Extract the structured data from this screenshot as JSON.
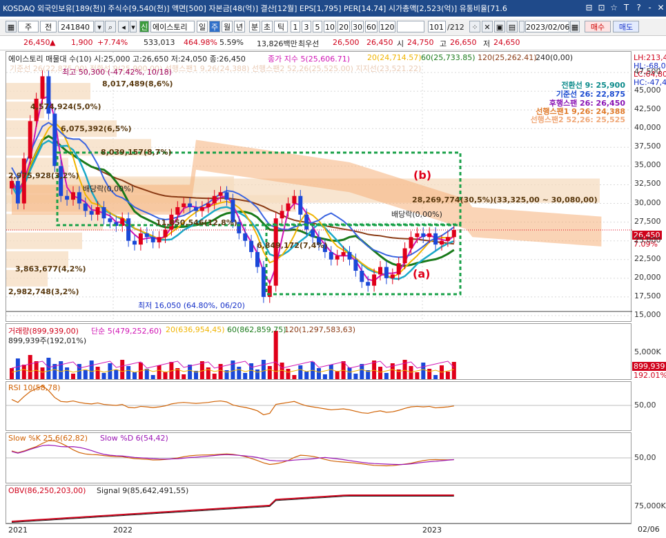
{
  "window": {
    "title": "KOSDAQ 외국인보유[189(천)] 주식수[9,540(천)] 액면[500] 자본금[48(억)] 결산[12월] EPS[1,795] PER[14.74] 시가총액[2,523(억)] 유통비율[71.6",
    "buttons": [
      "⊟",
      "⊡",
      "☆",
      "T",
      "?",
      "-",
      "✕"
    ]
  },
  "toolbar": {
    "code": "241840",
    "period_short": "주",
    "period_kind": "전",
    "stock_tag": "신",
    "stock_name": "에이스토리",
    "periods": [
      "일",
      "주",
      "월",
      "년",
      "분",
      "초",
      "틱"
    ],
    "active_period": "주",
    "ticks": [
      "1",
      "3",
      "5",
      "10",
      "20",
      "30",
      "60",
      "120"
    ],
    "count": "101",
    "count_total": "/212",
    "date": "2023/02/06",
    "buy": "매수",
    "sell": "매도"
  },
  "quote": {
    "price": "26,450",
    "arrow": "▲",
    "change": "1,900",
    "change_pct": "+7.74%",
    "volume": "533,013",
    "vol_ratio": "464.98%",
    "turnover": "5.59%",
    "amount": "13,826백만",
    "quote_side": "최우선",
    "bid": "26,500",
    "ask": "26,450",
    "open_label": "시",
    "open": "24,750",
    "high_label": "고",
    "high": "26,650",
    "low_label": "저",
    "low": "24,650"
  },
  "price_pane": {
    "header": "에이스토리 매물대 수(10)  시:25,000 고:26,650 저:24,050 종:26,450",
    "ma_items": [
      {
        "label": "종가 지수 5(25,606.71)",
        "color": "#d014b4"
      },
      {
        "label": "20(24,714.57)",
        "color": "#f0b400"
      },
      {
        "label": "60(25,733.85)",
        "color": "#1a7a1a"
      },
      {
        "label": "120(25,262.41)",
        "color": "#8a3a14"
      },
      {
        "label": "240(0,00)",
        "color": "#222222"
      }
    ],
    "ichimoku_header": "기준선 26(22,875.00) 전환선 9(25,900.00) 선행스팬1 9,26(24,388) 선행스팬2 52,26(25,525.00)  지지선(23,521.22)",
    "ichimoku_legend": [
      {
        "label": "전환선 9: 25,900",
        "color": "#0a8a8a"
      },
      {
        "label": "기준선 26: 22,875",
        "color": "#1a4ad0"
      },
      {
        "label": "후행스팬 26: 26,450",
        "color": "#8a14b4"
      },
      {
        "label": "선행스팬1 9,26: 24,388",
        "color": "#e07a2a"
      },
      {
        "label": "선행스팬2 52,26: 25,525",
        "color": "#f0a878"
      }
    ],
    "right_tags": [
      {
        "label": "LH:213,40",
        "color": "#d0021b"
      },
      {
        "label": "HL:-68,09",
        "color": "#1530c8"
      },
      {
        "label": "LC:64,80",
        "color": "#d0021b"
      },
      {
        "label": "HC:-47,42",
        "color": "#1530c8"
      }
    ],
    "y_ticks": [
      "47,500",
      "45,000",
      "42,500",
      "40,000",
      "37,500",
      "35,000",
      "32,500",
      "30,000",
      "27,500",
      "25,000",
      "22,500",
      "20,000",
      "17,500",
      "15,000"
    ],
    "current_price_tag": "26,450",
    "current_pct_tag": "7.09%",
    "annotations": {
      "high": "최고 50,300 (-47.42%, 10/18)",
      "low": "최저 16,050 (64.80%, 06/20)",
      "vp1": "8,017,489(8,6%)",
      "vp2": "4,574,924(5,0%)",
      "vp3": "6,075,392(6,5%)",
      "vp4": "8,039,157(8,7%)",
      "vp5": "2,975,928(3,2%)",
      "vp6": "11,850,546(12,8%)",
      "vp7": "6,849,172(7,4%)",
      "vp8": "28,269,774(30,5%)(33,325,00 ~ 30,080,00)",
      "vp9": "3,863,677(4,2%)",
      "vp10": "2,982,748(3,2%)",
      "div1": "배당락(0,00%)",
      "div2": "배당락(0,00%)",
      "box_a": "(a)",
      "box_b": "(b)"
    }
  },
  "volume_pane": {
    "legend": [
      {
        "label": "거래량(899,939,00)",
        "color": "#d0021b"
      },
      {
        "label": "단순 5(479,252,60)",
        "color": "#d014b4"
      },
      {
        "label": "20(636,954,45)",
        "color": "#f0b400"
      },
      {
        "label": "60(862,859,75)",
        "color": "#1a7a1a"
      },
      {
        "label": "120(1,297,583,63)",
        "color": "#8a3a14"
      }
    ],
    "sub": "899,939주(192,01%)",
    "y_ticks": [
      "5,000K"
    ],
    "tag_value": "899,939",
    "tag_pct": "192.01%"
  },
  "rsi_pane": {
    "legend": "RSI 10(58,78)",
    "y_ticks": [
      "50,00"
    ]
  },
  "stoch_pane": {
    "legend_k": "Slow %K 25,6(62,82)",
    "legend_d": "Slow %D 6(54,42)",
    "y_ticks": [
      "50,00"
    ]
  },
  "obv_pane": {
    "legend_obv": "OBV(86,250,203,00)",
    "legend_sig": "Signal 9(85,642,491,55)",
    "y_ticks": [
      "75,000K"
    ]
  },
  "x_axis": {
    "labels": [
      "2021",
      "2022",
      "2023"
    ],
    "right": "02/06"
  },
  "chart_data": {
    "type": "candlestick",
    "y_axis_range": [
      15000,
      47500
    ],
    "closes": [
      33000,
      30000,
      36000,
      41000,
      44000,
      47000,
      42000,
      35000,
      31000,
      30500,
      31500,
      30000,
      29000,
      28500,
      29500,
      28000,
      27500,
      27000,
      28000,
      25000,
      24500,
      26000,
      25500,
      24800,
      25500,
      26500,
      28500,
      29500,
      30000,
      29500,
      29000,
      29500,
      30000,
      31000,
      31500,
      30500,
      27500,
      26000,
      25000,
      23500,
      21500,
      17500,
      19000,
      28000,
      29000,
      30000,
      31000,
      28500,
      26500,
      25500,
      24500,
      23500,
      22500,
      23000,
      23500,
      22500,
      21000,
      19500,
      19000,
      20500,
      21500,
      20000,
      20500,
      22000,
      24000,
      25500,
      26000,
      25500,
      26000,
      24500,
      25000,
      25500,
      26450
    ]
  }
}
